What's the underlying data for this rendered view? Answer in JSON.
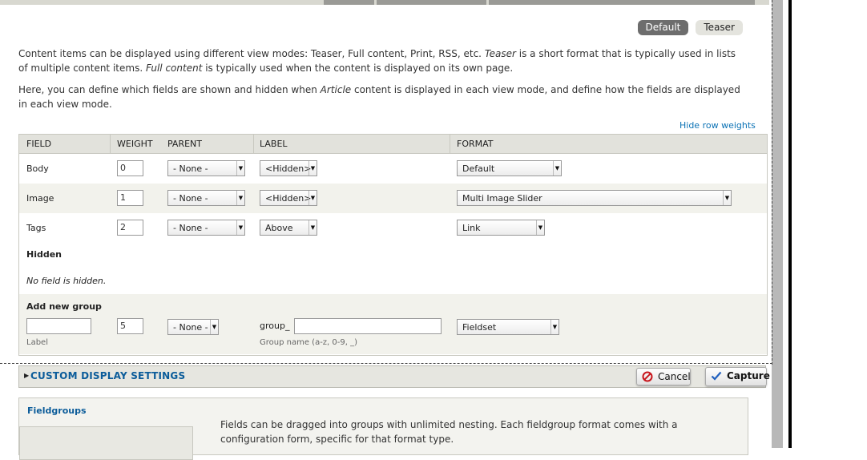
{
  "view_modes": [
    {
      "label": "Default",
      "active": true
    },
    {
      "label": "Teaser",
      "active": false
    }
  ],
  "description": {
    "p1_a": "Content items can be displayed using different view modes: Teaser, Full content, Print, RSS, etc. ",
    "p1_b": "Teaser",
    "p1_c": " is a short format that is typically used in lists of multiple content items. ",
    "p1_d": "Full content",
    "p1_e": " is typically used when the content is displayed on its own page.",
    "p2_a": "Here, you can define which fields are shown and hidden when ",
    "p2_b": "Article",
    "p2_c": " content is displayed in each view mode, and define how the fields are displayed in each view mode."
  },
  "hide_row_weights": "Hide row weights",
  "table": {
    "headers": {
      "field": "FIELD",
      "weight": "WEIGHT",
      "parent": "PARENT",
      "label": "LABEL",
      "format": "FORMAT"
    },
    "rows": [
      {
        "field": "Body",
        "weight": "0",
        "parent": "- None -",
        "label": "<Hidden>",
        "format": "Default"
      },
      {
        "field": "Image",
        "weight": "1",
        "parent": "- None -",
        "label": "<Hidden>",
        "format": "Multi Image Slider"
      },
      {
        "field": "Tags",
        "weight": "2",
        "parent": "- None -",
        "label": "Above",
        "format": "Link"
      }
    ],
    "hidden_title": "Hidden",
    "hidden_empty": "No field is hidden.",
    "add_group": {
      "title": "Add new group",
      "label_value": "",
      "label_caption": "Label",
      "weight": "5",
      "parent": "- None -",
      "group_prefix": "group_",
      "group_name_value": "",
      "group_caption": "Group name (a-z, 0-9, _)",
      "format": "Fieldset"
    }
  },
  "custom_display": {
    "label": "CUSTOM DISPLAY SETTINGS"
  },
  "buttons": {
    "cancel": "Cancel",
    "capture": "Capture"
  },
  "fieldgroups": {
    "title": "Fieldgroups",
    "text": "Fields can be dragged into groups with unlimited nesting. Each fieldgroup format comes with a configuration form, specific for that format type."
  },
  "colors": {
    "link": "#0b72b5",
    "header_bg": "#e2e2dc",
    "alt_row": "#f2f2ec",
    "active_tab": "#6d6d6d"
  }
}
